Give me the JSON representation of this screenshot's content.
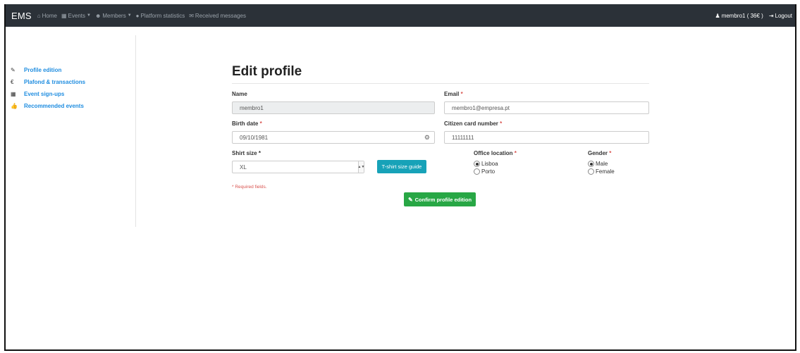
{
  "navbar": {
    "brand": "EMS",
    "items": [
      {
        "icon": "home-icon",
        "glyph": "⌂",
        "label": "Home",
        "caret": false
      },
      {
        "icon": "calendar-icon",
        "glyph": "▦",
        "label": "Events",
        "caret": true
      },
      {
        "icon": "users-icon",
        "glyph": "☻",
        "label": "Members",
        "caret": true
      },
      {
        "icon": "globe-icon",
        "glyph": "●",
        "label": "Platform statistics",
        "caret": false
      },
      {
        "icon": "envelope-icon",
        "glyph": "✉",
        "label": "Received messages",
        "caret": false
      }
    ],
    "user": {
      "glyph": "♟",
      "label": "membro1 ( 36€ )"
    },
    "logout": {
      "glyph": "⇥",
      "label": "Logout"
    }
  },
  "sidebar": {
    "items": [
      {
        "glyph": "✎",
        "label": "Profile edition"
      },
      {
        "glyph": "€",
        "label": "Plafond & transactions"
      },
      {
        "glyph": "▦",
        "label": "Event sign-ups"
      },
      {
        "glyph": "👍",
        "label": "Recommended events"
      }
    ]
  },
  "form": {
    "title": "Edit profile",
    "name": {
      "label": "Name",
      "value": "membro1"
    },
    "email": {
      "label": "Email",
      "required_mark": "*",
      "value": "membro1@empresa.pt"
    },
    "birth_date": {
      "label": "Birth date",
      "required_mark": "*",
      "value": "09/10/1981",
      "icon_glyph": "⚙"
    },
    "citizen_card": {
      "label": "Citizen card number",
      "required_mark": "*",
      "value": "11111111"
    },
    "shirt_size": {
      "label": "Shirt size",
      "required_mark": "*",
      "value": "XL"
    },
    "size_guide_button": "T-shirt size guide",
    "office_location": {
      "label": "Office location",
      "required_mark": "*",
      "options": [
        "Lisboa",
        "Porto"
      ],
      "selected": "Lisboa"
    },
    "gender": {
      "label": "Gender",
      "required_mark": "*",
      "options": [
        "Male",
        "Female"
      ],
      "selected": "Male"
    },
    "required_note": "* Required fields.",
    "confirm_button": {
      "glyph": "✎",
      "label": "Confirm profile edition"
    }
  },
  "colors": {
    "navbar_bg": "#2b3138",
    "link": "#1f8de0",
    "info": "#17a2b8",
    "success": "#28a745",
    "required": "#d9534f"
  }
}
